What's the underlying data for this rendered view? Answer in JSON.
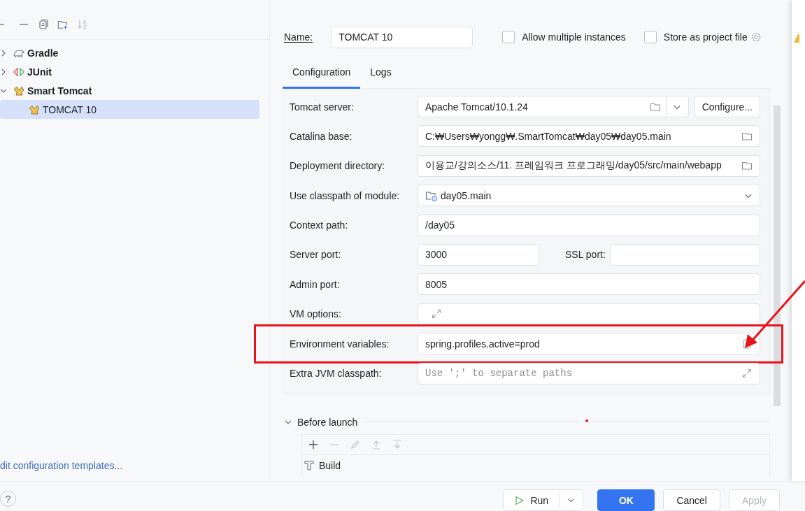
{
  "tree": [
    {
      "label": "Gradle",
      "kind": "gradle",
      "expanded": false,
      "selected": false
    },
    {
      "label": "JUnit",
      "kind": "junit",
      "expanded": false,
      "selected": false
    },
    {
      "label": "Smart Tomcat",
      "kind": "tomcat",
      "expanded": true,
      "selected": false,
      "children": [
        {
          "label": "TOMCAT 10",
          "kind": "tomcat",
          "selected": true
        }
      ]
    }
  ],
  "templates_link": "dit configuration templates...",
  "help": "?",
  "name": {
    "label": "Name:",
    "value": "TOMCAT 10"
  },
  "options": [
    {
      "label": "Allow multiple instances",
      "checked": false
    },
    {
      "label": "Store as project file",
      "checked": false
    }
  ],
  "tabs": [
    {
      "label": "Configuration",
      "selected": true
    },
    {
      "label": "Logs",
      "selected": false
    }
  ],
  "fields": [
    {
      "label": "Tomcat server:",
      "kind": "server",
      "value": "Apache Tomcat/10.1.24",
      "button": "Configure..."
    },
    {
      "label": "Catalina base:",
      "kind": "browse",
      "value": "C:₩Users₩yongg₩.SmartTomcat₩day05₩day05.main"
    },
    {
      "label": "Deployment directory:",
      "kind": "browse",
      "value": "이용교/강의소스/11. 프레임워크 프로그래밍/day05/src/main/webapp"
    },
    {
      "label": "Use classpath of module:",
      "kind": "module",
      "value": "day05.main"
    },
    {
      "label": "Context path:",
      "kind": "text",
      "value": "/day05"
    },
    {
      "label": "Server port:",
      "kind": "ports",
      "value": "3000",
      "second_label": "SSL port:"
    },
    {
      "label": "Admin port:",
      "kind": "text",
      "value": "8005"
    },
    {
      "label": "VM options:",
      "kind": "expand"
    },
    {
      "label": "Environment variables:",
      "kind": "env",
      "value": "spring.profiles.active=prod",
      "highlighted": true
    },
    {
      "label": "Extra JVM classpath:",
      "kind": "expand",
      "placeholder": "Use ';' to separate paths"
    }
  ],
  "before_launch": {
    "title": "Before launch",
    "expanded": true,
    "tasks": [
      {
        "label": "Build"
      }
    ]
  },
  "buttons": [
    {
      "label": "Run",
      "kind": "run"
    },
    {
      "label": "OK",
      "kind": "primary",
      "disabled": false
    },
    {
      "label": "Cancel",
      "kind": "normal",
      "disabled": false
    },
    {
      "label": "Apply",
      "kind": "normal",
      "disabled": true
    }
  ]
}
